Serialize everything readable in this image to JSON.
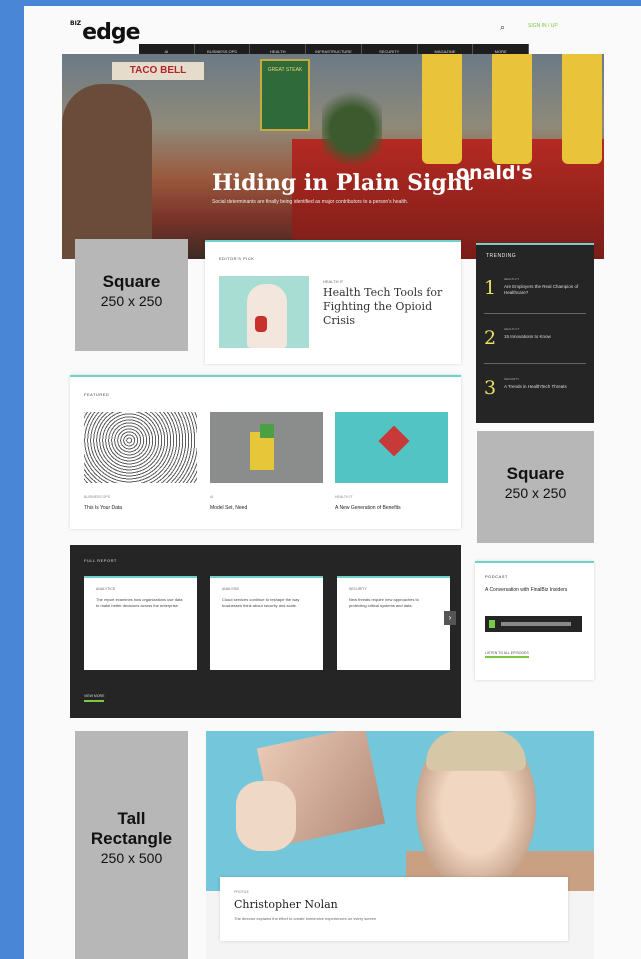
{
  "header": {
    "logo_prefix": "BIZ",
    "logo": "edge",
    "search_icon": "search-icon",
    "signin": "SIGN IN / UP",
    "nav": [
      "AI",
      "BUSINESS OPS",
      "HEALTH",
      "INFRASTRUCTURE",
      "SECURITY",
      "MAGAZINE",
      "MORE"
    ]
  },
  "hero": {
    "title": "Hiding in Plain Sight",
    "overlay_text": "onald's",
    "sign_left": "TACO BELL",
    "sign_green": "GREAT STEAK",
    "subtitle": "Social determinants are finally being identified as major contributors to a person's health."
  },
  "ads": {
    "square1": {
      "title": "Square",
      "dims": "250 x 250"
    },
    "square2": {
      "title": "Square",
      "dims": "250 x 250"
    },
    "tall": {
      "title_line1": "Tall",
      "title_line2": "Rectangle",
      "dims": "250 x 500"
    }
  },
  "editors_pick": {
    "heading": "EDITOR'S PICK",
    "kicker": "HEALTH IT",
    "title": "Health Tech Tools for Fighting the Opioid Crisis"
  },
  "trending": {
    "heading": "TRENDING",
    "items": [
      {
        "num": "1",
        "meta": "HEALTH IT",
        "text": "Are Employers the Real Champion of Healthcare?"
      },
      {
        "num": "2",
        "meta": "HEALTH IT",
        "text": "15 Innovations to Know"
      },
      {
        "num": "3",
        "meta": "SECURITY",
        "text": "A Trends in HealthTech Threats"
      }
    ]
  },
  "featured": {
    "heading": "FEATURED",
    "items": [
      {
        "cat": "BUSINESS OPS",
        "title": "This Is Your Data"
      },
      {
        "cat": "AI",
        "title": "Model Set, Need"
      },
      {
        "cat": "HEALTH IT",
        "title": "A New Generation of Benefits"
      }
    ]
  },
  "full_report": {
    "heading": "FULL REPORT",
    "items": [
      {
        "cat": "ANALYTICS",
        "body": "The report examines how organizations use data to make better decisions across the enterprise."
      },
      {
        "cat": "ANALYSIS",
        "body": "Cloud services continue to reshape the way businesses think about security and scale."
      },
      {
        "cat": "SECURITY",
        "body": "New threats require new approaches to protecting critical systems and data."
      }
    ],
    "arrow": "›",
    "more": "VIEW MORE"
  },
  "podcast": {
    "heading": "PODCAST",
    "title": "A Conversation with FinalBiz Insiders",
    "link": "LISTEN TO ALL EPISODES"
  },
  "feature_story": {
    "kicker": "PROFILE",
    "title": "Christopher Nolan",
    "subtitle": "The director explains the effort to create immersive experiences on every screen"
  }
}
